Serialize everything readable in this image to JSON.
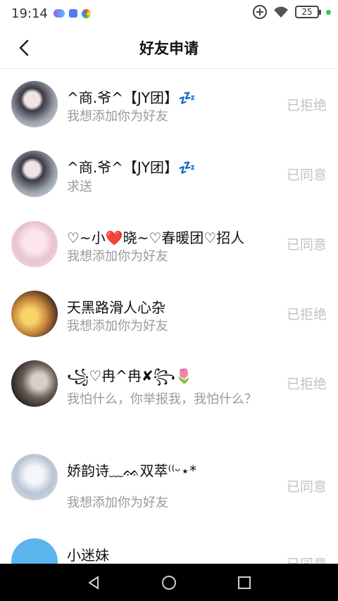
{
  "status_bar": {
    "time": "19:14",
    "battery": "25"
  },
  "header": {
    "title": "好友申请"
  },
  "requests": [
    {
      "name": "^商.爷^【JY团】💤",
      "message": "我想添加你为好友",
      "status": "已拒绝"
    },
    {
      "name": "^商.爷^【JY团】💤",
      "message": "求送",
      "status": "已同意"
    },
    {
      "name": "♡~小❤️晓~♡春暖团♡招人",
      "message": "我想添加你为好友",
      "status": "已同意"
    },
    {
      "name": "天黑路滑人心杂",
      "message": "我想添加你为好友",
      "status": "已拒绝"
    },
    {
      "name": "꧁♡冉^冉✘꧂🌷",
      "message": "我怕什么，你举报我，我怕什么？",
      "status": "已拒绝"
    },
    {
      "name": "娇韵诗﹏ᨐ双萃⁽⁽ᵕ⋆*",
      "message": "我想添加你为好友",
      "status": "已同意"
    },
    {
      "name": "小迷妹",
      "message": "",
      "status": "已同意"
    }
  ],
  "colors": {
    "status_text": "#c2c2c2",
    "message_text": "#9a9a9a",
    "nav_bg": "#000000"
  }
}
